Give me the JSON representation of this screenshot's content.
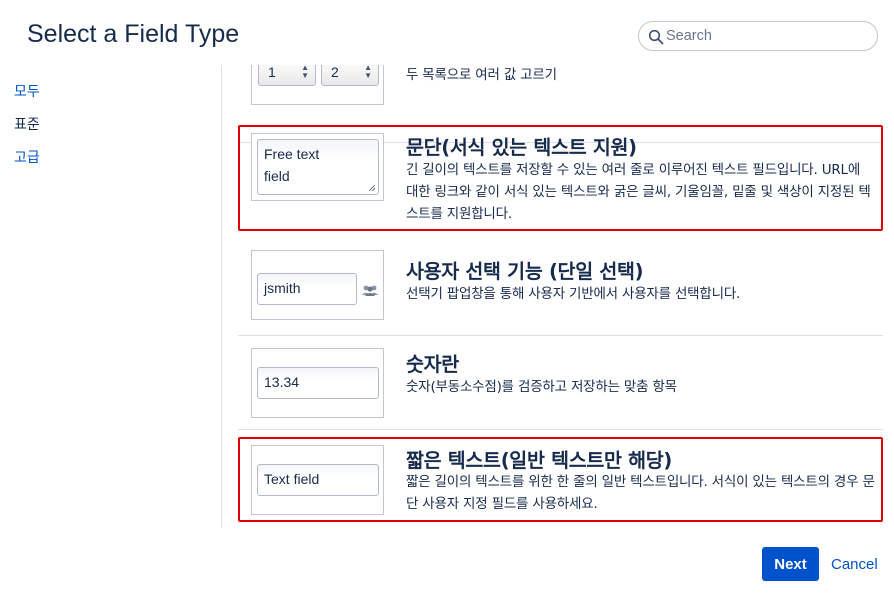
{
  "dialog": {
    "title": "Select a Field Type"
  },
  "search": {
    "placeholder": "Search",
    "value": ""
  },
  "sidebar": {
    "items": [
      {
        "label": "모두",
        "active": false
      },
      {
        "label": "표준",
        "active": true
      },
      {
        "label": "고급",
        "active": false
      }
    ]
  },
  "fields": [
    {
      "name": "",
      "description": "두 목록으로 여러 값 고르기",
      "preview": {
        "values": [
          "1",
          "2"
        ]
      }
    },
    {
      "name": "문단(서식 있는 텍스트 지원)",
      "description": "긴 길이의 텍스트를 저장할 수 있는 여러 줄로 이루어진 텍스트 필드입니다. URL에 대한 링크와 같이 서식 있는 텍스트와 굵은 글씨, 기울임꼴, 밑줄 및 색상이 지정된 텍스트를 지원합니다.",
      "preview": {
        "text_line1": "Free text",
        "text_line2": "field"
      },
      "highlighted": true
    },
    {
      "name": "사용자 선택 기능 (단일 선택)",
      "description": "선택기 팝업창을 통해 사용자 기반에서 사용자를 선택합니다.",
      "preview": {
        "text": "jsmith"
      }
    },
    {
      "name": "숫자란",
      "description": "숫자(부동소수점)를 검증하고 저장하는 맞춤 항목",
      "preview": {
        "text": "13.34"
      }
    },
    {
      "name": "짧은 텍스트(일반 텍스트만 해당)",
      "description": "짧은 길이의 텍스트를 위한 한 줄의 일반 텍스트입니다. 서식이 있는 텍스트의 경우 문단 사용자 지정 필드를 사용하세요.",
      "preview": {
        "text": "Text field"
      },
      "highlighted": true
    }
  ],
  "footer": {
    "next_label": "Next",
    "cancel_label": "Cancel"
  },
  "colors": {
    "highlight": "#e00000",
    "primary": "#0052cc",
    "text": "#172b4d"
  }
}
